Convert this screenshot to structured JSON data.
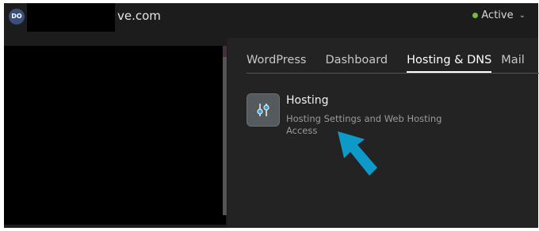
{
  "header": {
    "logo_initials": "DO",
    "domain_suffix": "ve.com",
    "status_label": "Active",
    "status_color": "#7ab648"
  },
  "tabs": [
    {
      "label": "WordPress",
      "active": false
    },
    {
      "label": "Dashboard",
      "active": false
    },
    {
      "label": "Hosting & DNS",
      "active": true
    },
    {
      "label": "Mail",
      "active": false
    }
  ],
  "hosting_card": {
    "icon": "sliders-icon",
    "title": "Hosting",
    "description": "Hosting Settings and Web Hosting Access"
  },
  "annotation": {
    "icon": "pointer-arrow-icon",
    "color": "#0d9ac9"
  }
}
